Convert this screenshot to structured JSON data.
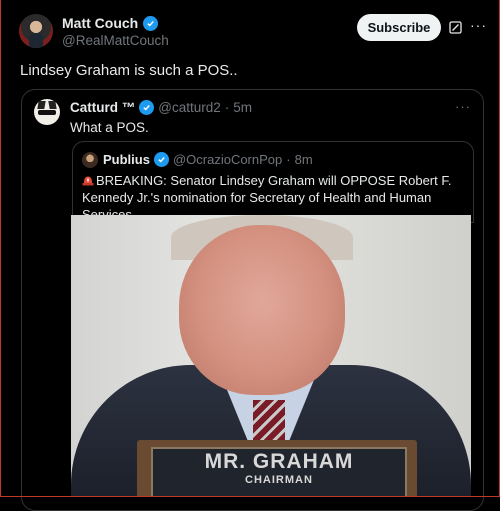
{
  "post": {
    "author_name": "Matt Couch",
    "author_handle": "@RealMattCouch",
    "subscribe_label": "Subscribe",
    "more_icon": "more-horizontal-icon",
    "text": "Lindsey Graham is such a POS.."
  },
  "quoted_post": {
    "author_name": "Catturd ™",
    "author_handle": "@catturd2",
    "separator": "·",
    "time": "5m",
    "text": "What a POS."
  },
  "nested_quote": {
    "author_name": "Publius",
    "author_handle": "@OcrazioCornPop",
    "separator": "·",
    "time": "8m",
    "text": "BREAKING:  Senator Lindsey Graham will OPPOSE Robert F. Kennedy Jr.'s nomination for Secretary of Health and Human Services.",
    "siren_icon": "siren-icon"
  },
  "photo": {
    "nameplate_name": "MR. GRAHAM",
    "nameplate_title": "CHAIRMAN"
  },
  "colors": {
    "background": "#000000",
    "text": "#e7e9ea",
    "muted": "#71767b",
    "verified": "#1d9bf0",
    "border": "#2f3336"
  }
}
